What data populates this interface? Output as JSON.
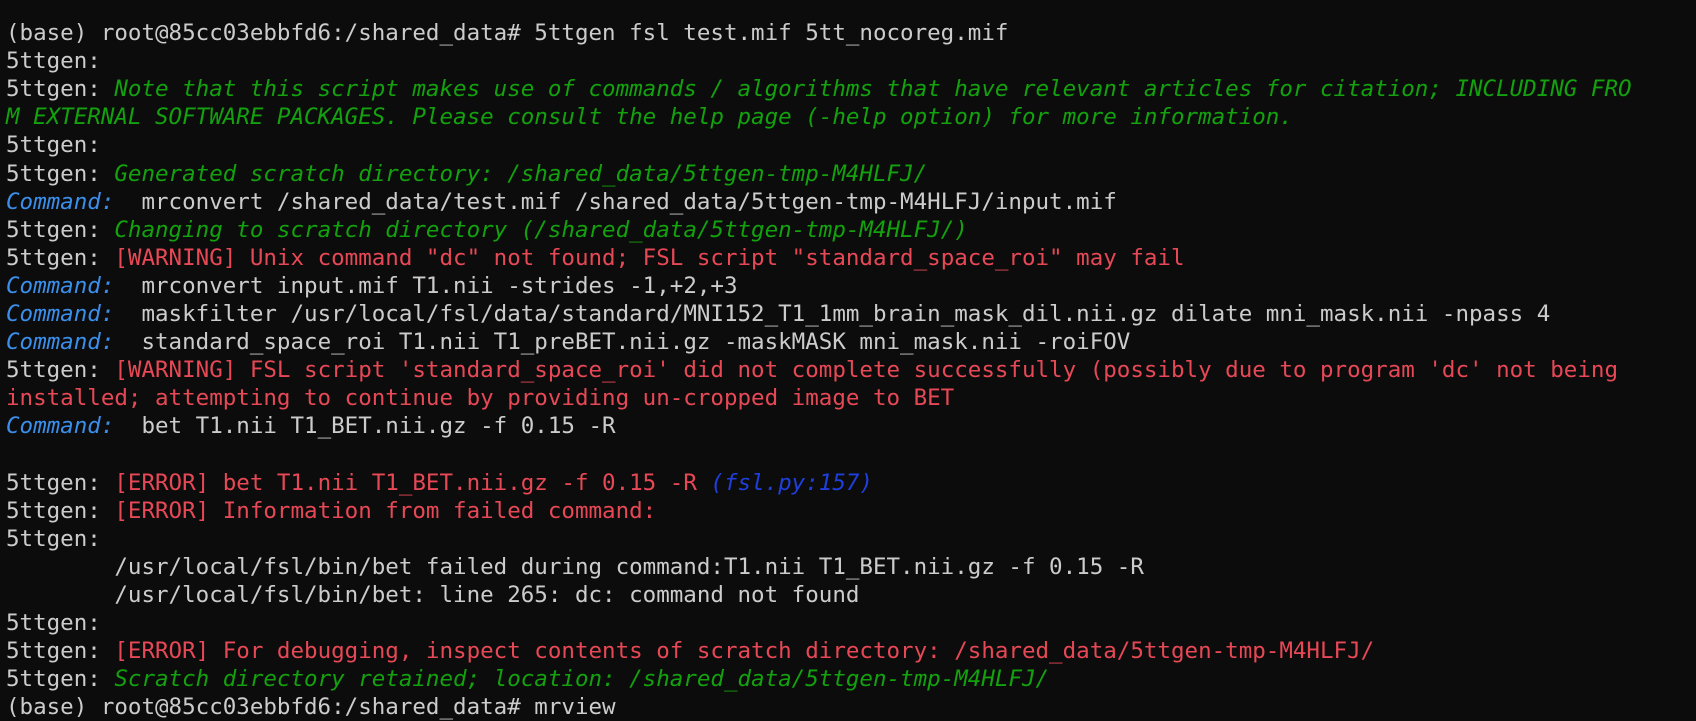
{
  "terminal": {
    "lines": [
      {
        "segments": [
          {
            "text": "",
            "cls": "white"
          }
        ]
      },
      {
        "segments": [
          {
            "text": "(base) root@85cc03ebbfd6:/shared_data# 5ttgen fsl test.mif 5tt_nocoreg.mif",
            "cls": "white"
          }
        ]
      },
      {
        "segments": [
          {
            "text": "5ttgen:",
            "cls": "white"
          }
        ]
      },
      {
        "segments": [
          {
            "text": "5ttgen: ",
            "cls": "white"
          },
          {
            "text": "Note that this script makes use of commands / algorithms that have relevant articles for citation; INCLUDING FRO",
            "cls": "green"
          }
        ]
      },
      {
        "segments": [
          {
            "text": "M EXTERNAL SOFTWARE PACKAGES. Please consult the help page (-help option) for more information.",
            "cls": "green"
          }
        ]
      },
      {
        "segments": [
          {
            "text": "5ttgen:",
            "cls": "white"
          }
        ]
      },
      {
        "segments": [
          {
            "text": "5ttgen: ",
            "cls": "white"
          },
          {
            "text": "Generated scratch directory: /shared_data/5ttgen-tmp-M4HLFJ/",
            "cls": "green"
          }
        ]
      },
      {
        "segments": [
          {
            "text": "Command:",
            "cls": "blue-cmd"
          },
          {
            "text": "  mrconvert /shared_data/test.mif /shared_data/5ttgen-tmp-M4HLFJ/input.mif",
            "cls": "white"
          }
        ]
      },
      {
        "segments": [
          {
            "text": "5ttgen: ",
            "cls": "white"
          },
          {
            "text": "Changing to scratch directory (/shared_data/5ttgen-tmp-M4HLFJ/)",
            "cls": "green"
          }
        ]
      },
      {
        "segments": [
          {
            "text": "5ttgen: ",
            "cls": "white"
          },
          {
            "text": "[WARNING] Unix command \"dc\" not found; FSL script \"standard_space_roi\" may fail",
            "cls": "red"
          }
        ]
      },
      {
        "segments": [
          {
            "text": "Command:",
            "cls": "blue-cmd"
          },
          {
            "text": "  mrconvert input.mif T1.nii -strides -1,+2,+3",
            "cls": "white"
          }
        ]
      },
      {
        "segments": [
          {
            "text": "Command:",
            "cls": "blue-cmd"
          },
          {
            "text": "  maskfilter /usr/local/fsl/data/standard/MNI152_T1_1mm_brain_mask_dil.nii.gz dilate mni_mask.nii -npass 4",
            "cls": "white"
          }
        ]
      },
      {
        "segments": [
          {
            "text": "Command:",
            "cls": "blue-cmd"
          },
          {
            "text": "  standard_space_roi T1.nii T1_preBET.nii.gz -maskMASK mni_mask.nii -roiFOV",
            "cls": "white"
          }
        ]
      },
      {
        "segments": [
          {
            "text": "5ttgen: ",
            "cls": "white"
          },
          {
            "text": "[WARNING] FSL script 'standard_space_roi' did not complete successfully (possibly due to program 'dc' not being",
            "cls": "red"
          }
        ]
      },
      {
        "segments": [
          {
            "text": "installed; attempting to continue by providing un-cropped image to BET",
            "cls": "red"
          }
        ]
      },
      {
        "segments": [
          {
            "text": "Command:",
            "cls": "blue-cmd"
          },
          {
            "text": "  bet T1.nii T1_BET.nii.gz -f 0.15 -R",
            "cls": "white"
          }
        ]
      },
      {
        "segments": [
          {
            "text": "",
            "cls": "white"
          }
        ]
      },
      {
        "segments": [
          {
            "text": "5ttgen: ",
            "cls": "white"
          },
          {
            "text": "[ERROR] bet T1.nii T1_BET.nii.gz -f 0.15 -R ",
            "cls": "red"
          },
          {
            "text": "(fsl.py:157)",
            "cls": "blue-ref"
          }
        ]
      },
      {
        "segments": [
          {
            "text": "5ttgen: ",
            "cls": "white"
          },
          {
            "text": "[ERROR] Information from failed command:",
            "cls": "red"
          }
        ]
      },
      {
        "segments": [
          {
            "text": "5ttgen:",
            "cls": "white"
          }
        ]
      },
      {
        "segments": [
          {
            "text": "        /usr/local/fsl/bin/bet failed during command:T1.nii T1_BET.nii.gz -f 0.15 -R",
            "cls": "white"
          }
        ]
      },
      {
        "segments": [
          {
            "text": "        /usr/local/fsl/bin/bet: line 265: dc: command not found",
            "cls": "white"
          }
        ]
      },
      {
        "segments": [
          {
            "text": "5ttgen:",
            "cls": "white"
          }
        ]
      },
      {
        "segments": [
          {
            "text": "5ttgen: ",
            "cls": "white"
          },
          {
            "text": "[ERROR] For debugging, inspect contents of scratch directory: /shared_data/5ttgen-tmp-M4HLFJ/",
            "cls": "red"
          }
        ]
      },
      {
        "segments": [
          {
            "text": "5ttgen: ",
            "cls": "white"
          },
          {
            "text": "Scratch directory retained; location: /shared_data/5ttgen-tmp-M4HLFJ/",
            "cls": "green"
          }
        ]
      },
      {
        "segments": [
          {
            "text": "(base) root@85cc03ebbfd6:/shared_data# mrview",
            "cls": "white"
          }
        ]
      }
    ]
  }
}
